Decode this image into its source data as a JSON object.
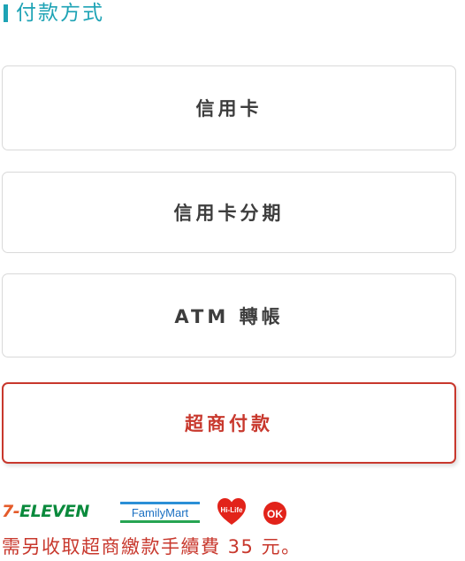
{
  "section": {
    "title": "付款方式"
  },
  "payment_options": [
    {
      "label": "信用卡",
      "selected": false
    },
    {
      "label": "信用卡分期",
      "selected": false
    },
    {
      "label": "ATM 轉帳",
      "selected": false
    },
    {
      "label": "超商付款",
      "selected": true
    }
  ],
  "store_logos": {
    "seven_eleven": {
      "number": "7",
      "dash": "-",
      "text": "ELEVEN"
    },
    "family_mart": "FamilyMart",
    "hi_life": "Hi-Life",
    "ok_mart": "OK"
  },
  "fee_note": "需另收取超商繳款手續費 35 元。",
  "colors": {
    "accent": "#1ea3b5",
    "selected": "#c8382d",
    "border": "#d9d9d9",
    "text": "#3d3d3d"
  }
}
